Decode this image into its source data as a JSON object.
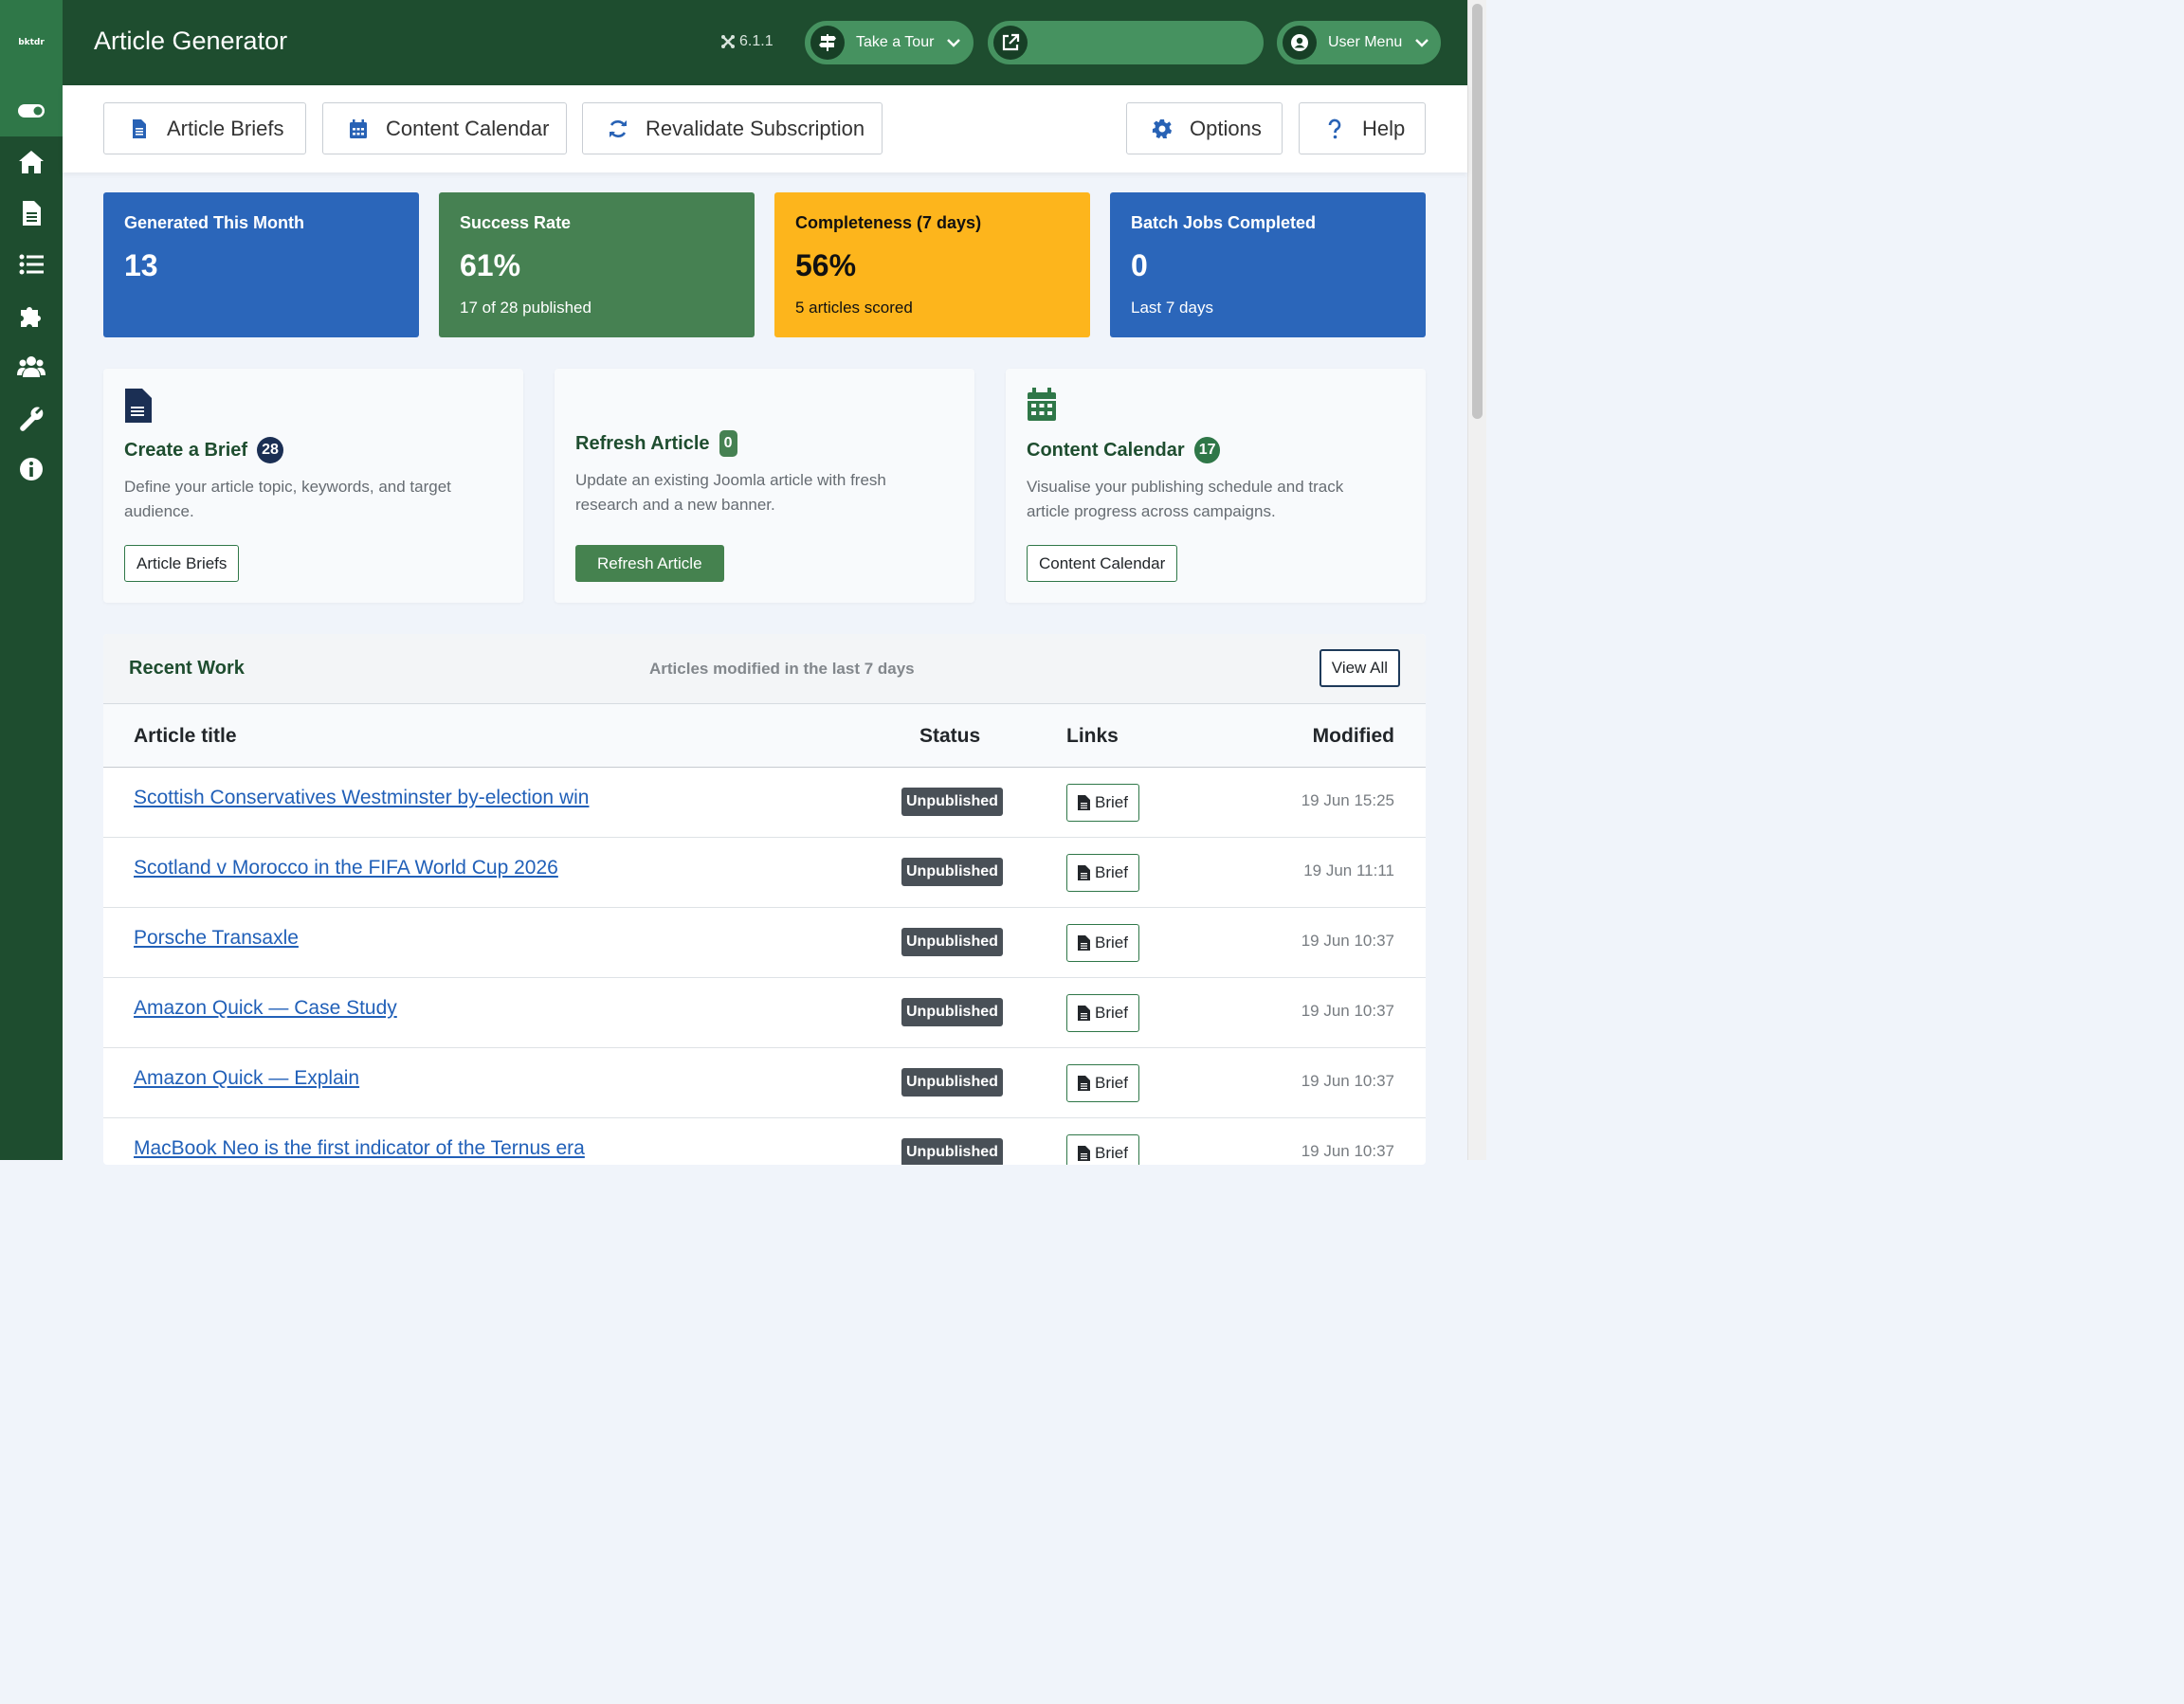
{
  "sidebar": {
    "logo": "bktdr",
    "items": [
      {
        "icon": "toggle-icon"
      },
      {
        "icon": "home-icon"
      },
      {
        "icon": "document-icon"
      },
      {
        "icon": "list-icon"
      },
      {
        "icon": "puzzle-icon"
      },
      {
        "icon": "users-icon"
      },
      {
        "icon": "wrench-icon"
      },
      {
        "icon": "info-icon"
      }
    ]
  },
  "header": {
    "title": "Article Generator",
    "version": "6.1.1",
    "tour_label": "Take a Tour",
    "user_menu_label": "User Menu"
  },
  "toolbar": {
    "article_briefs": "Article Briefs",
    "content_calendar": "Content Calendar",
    "revalidate": "Revalidate Subscription",
    "options": "Options",
    "help": "Help"
  },
  "stats": [
    {
      "label": "Generated This Month",
      "value": "13",
      "sub": "",
      "color": "#2b66ba"
    },
    {
      "label": "Success Rate",
      "value": "61%",
      "sub": "17 of 28 published",
      "color": "#468152"
    },
    {
      "label": "Completeness (7 days)",
      "value": "56%",
      "sub": "5 articles scored",
      "color": "#fdb51c"
    },
    {
      "label": "Batch Jobs Completed",
      "value": "0",
      "sub": "Last 7 days",
      "color": "#2b66ba"
    }
  ],
  "actions": [
    {
      "title": "Create a Brief",
      "count": "28",
      "desc": "Define your article topic, keywords, and target audience.",
      "button": "Article Briefs"
    },
    {
      "title": "Refresh Article",
      "count": "0",
      "desc": "Update an existing Joomla article with fresh research and a new banner.",
      "button": "Refresh Article"
    },
    {
      "title": "Content Calendar",
      "count": "17",
      "desc": "Visualise your publishing schedule and track article progress across campaigns.",
      "button": "Content Calendar"
    }
  ],
  "recent": {
    "title": "Recent Work",
    "subtitle": "Articles modified in the last 7 days",
    "view_all": "View All",
    "columns": {
      "title": "Article title",
      "status": "Status",
      "links": "Links",
      "modified": "Modified"
    },
    "rows": [
      {
        "title": "Scottish Conservatives Westminster by-election win",
        "status": "Unpublished",
        "link": "Brief",
        "modified": "19 Jun 15:25"
      },
      {
        "title": "Scotland v Morocco in the FIFA World Cup 2026",
        "status": "Unpublished",
        "link": "Brief",
        "modified": "19 Jun 11:11"
      },
      {
        "title": "Porsche Transaxle",
        "status": "Unpublished",
        "link": "Brief",
        "modified": "19 Jun 10:37"
      },
      {
        "title": "Amazon Quick — Case Study",
        "status": "Unpublished",
        "link": "Brief",
        "modified": "19 Jun 10:37"
      },
      {
        "title": "Amazon Quick — Explain",
        "status": "Unpublished",
        "link": "Brief",
        "modified": "19 Jun 10:37"
      },
      {
        "title": "MacBook Neo is the first indicator of the Ternus era",
        "status": "Unpublished",
        "link": "Brief",
        "modified": "19 Jun 10:37"
      }
    ]
  }
}
